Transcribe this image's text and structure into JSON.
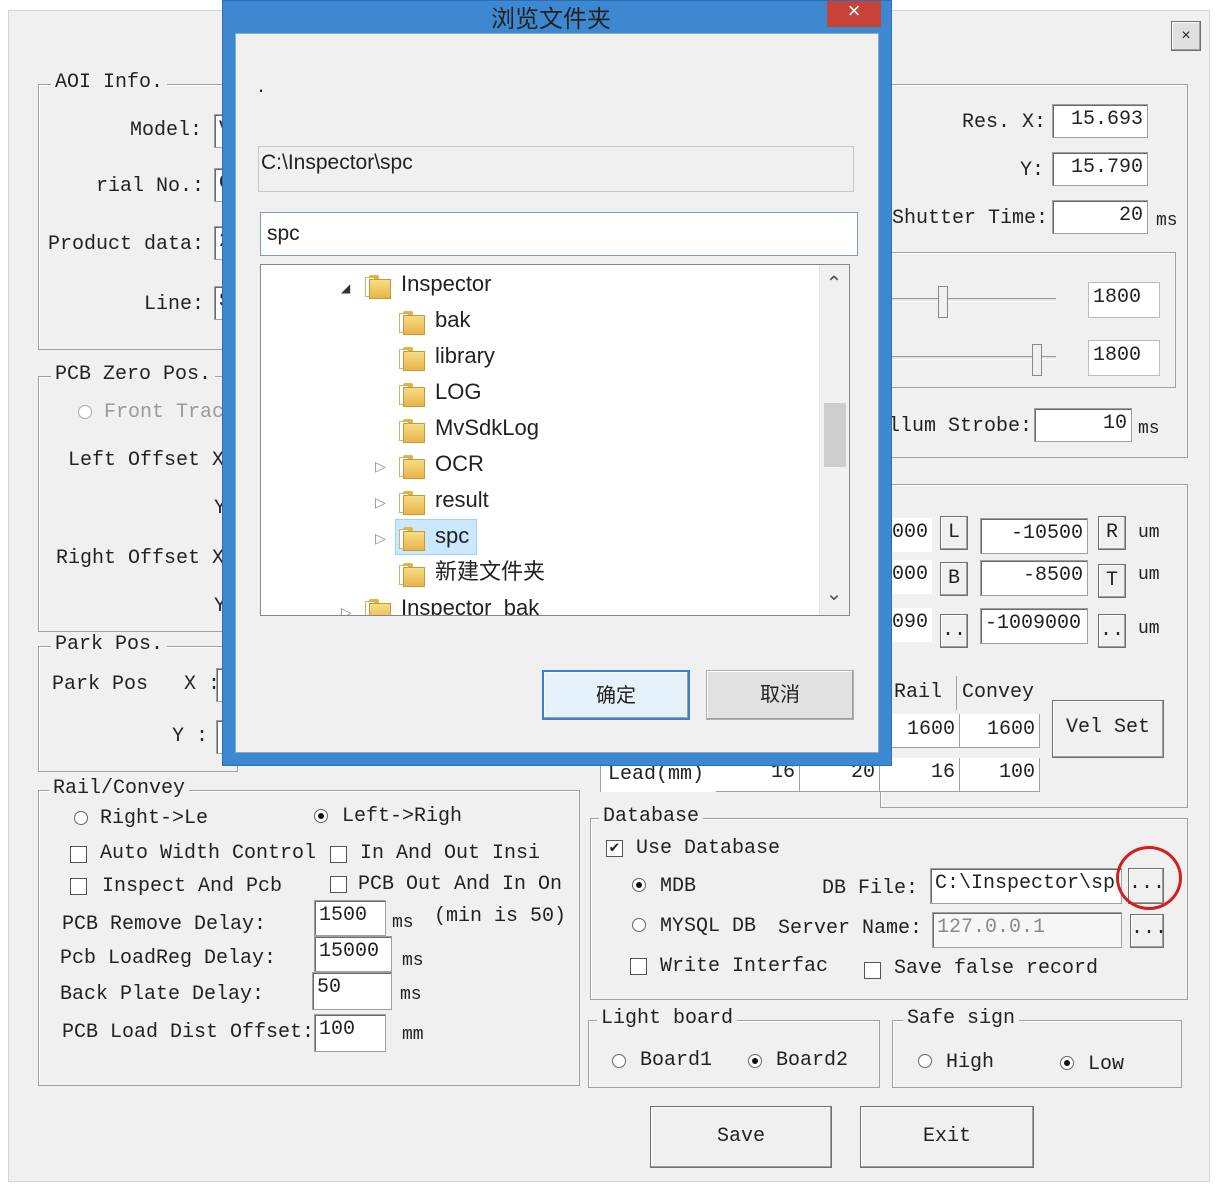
{
  "window": {
    "close_glyph": "×"
  },
  "aoi": {
    "group": "AOI Info.",
    "model_label": "Model:",
    "model_value": "V",
    "serial_label": "rial No.:",
    "serial_value": "C",
    "product_label": "Product data:",
    "product_value": "2",
    "line_label": "Line:",
    "line_value": "S"
  },
  "camera": {
    "res_x_label": "Res. X:",
    "res_x": "15.693",
    "res_y_label": "Y:",
    "res_y": "15.790",
    "shutter_label": "Shutter Time:",
    "shutter_value": "20",
    "shutter_unit": "ms",
    "slider1_value": "1800",
    "slider2_value": "1800",
    "illum_label": "llum Strobe:",
    "illum_value": "10",
    "illum_unit": "ms"
  },
  "pcb_zero": {
    "group": "PCB Zero Pos.",
    "front_track": "Front Trac",
    "left_offset_x": "Left Offset X",
    "left_offset_y": "Y",
    "right_offset_x": "Right Offset X",
    "right_offset_y": "Y"
  },
  "offsets": {
    "row1": {
      "partial": "000",
      "btn": "L",
      "value": "-10500",
      "btn2": "R",
      "unit": "um"
    },
    "row2": {
      "partial": "000",
      "btn": "B",
      "value": "-8500",
      "btn2": "T",
      "unit": "um"
    },
    "row3": {
      "partial": "090",
      "btn": "..",
      "value": "-1009000",
      "btn2": "..",
      "unit": "um"
    }
  },
  "park": {
    "group": "Park Pos.",
    "x_label": "Park Pos   X :",
    "y_label": "Y :"
  },
  "speed": {
    "col_rail": "Rail",
    "col_convey": "Convey",
    "row1": [
      "1600",
      "1600"
    ],
    "lead_label": "Lead(mm)",
    "lead_values": [
      "16",
      "20",
      "16",
      "100"
    ],
    "vel_set": "Vel Set"
  },
  "rail": {
    "group": "Rail/Convey",
    "right_left": "Right->Le",
    "left_right": "Left->Righ",
    "auto_width": "Auto Width Control",
    "in_out": "In And Out Insi",
    "inspect_pcb": "Inspect And Pcb",
    "pcb_out_in": "PCB Out And In On",
    "remove_label": "PCB Remove Delay:",
    "remove_value": "1500",
    "remove_unit": "ms",
    "remove_note": "(min is 50)",
    "loadreg_label": "Pcb LoadReg Delay:",
    "loadreg_value": "15000",
    "loadreg_unit": "ms",
    "back_label": "Back Plate Delay:",
    "back_value": "50",
    "back_unit": "ms",
    "dist_label": "PCB Load Dist Offset:",
    "dist_value": "100",
    "dist_unit": "mm"
  },
  "database": {
    "group": "Database",
    "use_db": "Use Database",
    "mdb": "MDB",
    "db_file_label": "DB File:",
    "db_file_value": "C:\\Inspector\\sp",
    "browse": "...",
    "mysql": "MYSQL DB",
    "server_label": "Server Name:",
    "server_value": "127.0.0.1",
    "browse2": "...",
    "write_interface": "Write Interfac",
    "save_false": "Save false record"
  },
  "light": {
    "group": "Light board",
    "board1": "Board1",
    "board2": "Board2"
  },
  "safe": {
    "group": "Safe sign",
    "high": "High",
    "low": "Low"
  },
  "actions": {
    "save": "Save",
    "exit": "Exit"
  },
  "dialog": {
    "title": "浏览文件夹",
    "close": "×",
    "description": ".",
    "path": "C:\\Inspector\\spc",
    "folder_input": "spc",
    "tree": [
      {
        "label": "Inspector",
        "expander": "◢"
      },
      {
        "label": "bak",
        "expander": ""
      },
      {
        "label": "library",
        "expander": ""
      },
      {
        "label": "LOG",
        "expander": ""
      },
      {
        "label": "MvSdkLog",
        "expander": ""
      },
      {
        "label": "OCR",
        "expander": "▷"
      },
      {
        "label": "result",
        "expander": "▷"
      },
      {
        "label": "spc",
        "expander": "▷"
      },
      {
        "label": "新建文件夹",
        "expander": ""
      },
      {
        "label": "Inspector_bak",
        "expander": "▷"
      }
    ],
    "scroll_up": "⌃",
    "scroll_down": "⌄",
    "ok": "确定",
    "cancel": "取消"
  }
}
